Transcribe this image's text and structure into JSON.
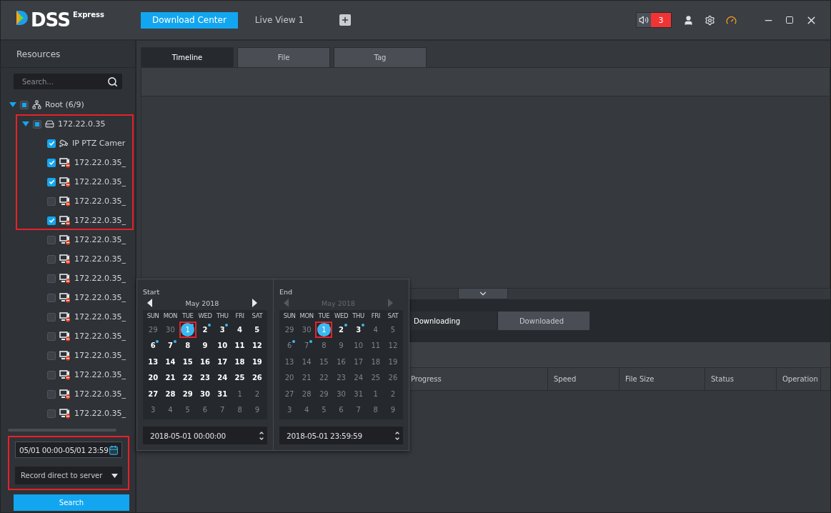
{
  "app": {
    "logo": "DSS",
    "edition": "Express"
  },
  "top_tabs": [
    {
      "label": "Download Center",
      "selected": true
    },
    {
      "label": "Live View 1",
      "selected": false
    }
  ],
  "alarm_count": "3",
  "sidebar": {
    "title": "Resources",
    "search_placeholder": "Search...",
    "tree": [
      {
        "label": "Root (6/9)",
        "kind": "root",
        "expanded": true,
        "partial": true,
        "framed": false,
        "children": [
          {
            "label": "172.22.0.35",
            "kind": "device",
            "expanded": true,
            "partial": true,
            "framed": true,
            "children": [
              {
                "label": "IP PTZ Camer",
                "kind": "ptz",
                "checked": true,
                "framed": true
              },
              {
                "label": "172.22.0.35_",
                "kind": "channel",
                "checked": true,
                "framed": true
              },
              {
                "label": "172.22.0.35_",
                "kind": "channel",
                "checked": true,
                "framed": true
              },
              {
                "label": "172.22.0.35_",
                "kind": "channel",
                "checked": false,
                "framed": true
              },
              {
                "label": "172.22.0.35_",
                "kind": "channel",
                "checked": true,
                "framed": true
              },
              {
                "label": "172.22.0.35_",
                "kind": "channel",
                "checked": false,
                "framed": false
              },
              {
                "label": "172.22.0.35_",
                "kind": "channel",
                "checked": false,
                "framed": false
              },
              {
                "label": "172.22.0.35_",
                "kind": "channel",
                "checked": false,
                "framed": false
              },
              {
                "label": "172.22.0.35_",
                "kind": "channel",
                "checked": false,
                "framed": false
              },
              {
                "label": "172.22.0.35_",
                "kind": "channel",
                "checked": false,
                "framed": false
              },
              {
                "label": "172.22.0.35_",
                "kind": "channel",
                "checked": false,
                "framed": false
              },
              {
                "label": "172.22.0.35_",
                "kind": "channel",
                "checked": false,
                "framed": false
              },
              {
                "label": "172.22.0.35_",
                "kind": "channel",
                "checked": false,
                "framed": false
              },
              {
                "label": "172.22.0.35_",
                "kind": "channel",
                "checked": false,
                "framed": false
              },
              {
                "label": "172.22.0.35_",
                "kind": "channel",
                "checked": false,
                "framed": false
              }
            ]
          }
        ]
      }
    ],
    "filters": {
      "framed": true,
      "time_range": "05/01 00:00-05/01 23:59",
      "record_source": "Record direct to server"
    },
    "search_button": "Search"
  },
  "view_tabs": [
    {
      "label": "Timeline",
      "selected": true
    },
    {
      "label": "File",
      "selected": false
    },
    {
      "label": "Tag",
      "selected": false
    }
  ],
  "task_tabs": [
    {
      "label": "Downloading",
      "selected": true
    },
    {
      "label": "Downloaded",
      "selected": false
    }
  ],
  "table": {
    "columns": [
      "Progress",
      "Speed",
      "File Size",
      "Status",
      "Operation"
    ]
  },
  "calendars": [
    {
      "label": "Start",
      "month": "May 2018",
      "nav_disabled": false,
      "time": "2018-05-01 00:00:00",
      "weekdays": [
        "SUN",
        "MON",
        "TUE",
        "WED",
        "THU",
        "FRI",
        "SAT"
      ],
      "days": [
        {
          "d": "29",
          "dim": true,
          "dot": false,
          "selected": false,
          "framed": false
        },
        {
          "d": "30",
          "dim": true,
          "dot": false,
          "selected": false,
          "framed": false
        },
        {
          "d": "1",
          "dim": false,
          "dot": true,
          "selected": true,
          "framed": true
        },
        {
          "d": "2",
          "dim": false,
          "dot": true,
          "selected": false,
          "framed": false
        },
        {
          "d": "3",
          "dim": false,
          "dot": true,
          "selected": false,
          "framed": false
        },
        {
          "d": "4",
          "dim": false,
          "dot": false,
          "selected": false,
          "framed": false
        },
        {
          "d": "5",
          "dim": false,
          "dot": false,
          "selected": false,
          "framed": false
        },
        {
          "d": "6",
          "dim": false,
          "dot": true,
          "selected": false,
          "framed": false
        },
        {
          "d": "7",
          "dim": false,
          "dot": true,
          "selected": false,
          "framed": false
        },
        {
          "d": "8",
          "dim": false,
          "dot": false,
          "selected": false,
          "framed": false
        },
        {
          "d": "9",
          "dim": false,
          "dot": false,
          "selected": false,
          "framed": false
        },
        {
          "d": "10",
          "dim": false,
          "dot": false,
          "selected": false,
          "framed": false
        },
        {
          "d": "11",
          "dim": false,
          "dot": false,
          "selected": false,
          "framed": false
        },
        {
          "d": "12",
          "dim": false,
          "dot": false,
          "selected": false,
          "framed": false
        },
        {
          "d": "13",
          "dim": false,
          "dot": false,
          "selected": false,
          "framed": false
        },
        {
          "d": "14",
          "dim": false,
          "dot": false,
          "selected": false,
          "framed": false
        },
        {
          "d": "15",
          "dim": false,
          "dot": false,
          "selected": false,
          "framed": false
        },
        {
          "d": "16",
          "dim": false,
          "dot": false,
          "selected": false,
          "framed": false
        },
        {
          "d": "17",
          "dim": false,
          "dot": false,
          "selected": false,
          "framed": false
        },
        {
          "d": "18",
          "dim": false,
          "dot": false,
          "selected": false,
          "framed": false
        },
        {
          "d": "19",
          "dim": false,
          "dot": false,
          "selected": false,
          "framed": false
        },
        {
          "d": "20",
          "dim": false,
          "dot": false,
          "selected": false,
          "framed": false
        },
        {
          "d": "21",
          "dim": false,
          "dot": false,
          "selected": false,
          "framed": false
        },
        {
          "d": "22",
          "dim": false,
          "dot": false,
          "selected": false,
          "framed": false
        },
        {
          "d": "23",
          "dim": false,
          "dot": false,
          "selected": false,
          "framed": false
        },
        {
          "d": "24",
          "dim": false,
          "dot": false,
          "selected": false,
          "framed": false
        },
        {
          "d": "25",
          "dim": false,
          "dot": false,
          "selected": false,
          "framed": false
        },
        {
          "d": "26",
          "dim": false,
          "dot": false,
          "selected": false,
          "framed": false
        },
        {
          "d": "27",
          "dim": false,
          "dot": false,
          "selected": false,
          "framed": false
        },
        {
          "d": "28",
          "dim": false,
          "dot": false,
          "selected": false,
          "framed": false
        },
        {
          "d": "29",
          "dim": false,
          "dot": false,
          "selected": false,
          "framed": false
        },
        {
          "d": "30",
          "dim": false,
          "dot": false,
          "selected": false,
          "framed": false
        },
        {
          "d": "31",
          "dim": false,
          "dot": false,
          "selected": false,
          "framed": false
        },
        {
          "d": "1",
          "dim": true,
          "dot": false,
          "selected": false,
          "framed": false
        },
        {
          "d": "2",
          "dim": true,
          "dot": false,
          "selected": false,
          "framed": false
        },
        {
          "d": "3",
          "dim": true,
          "dot": false,
          "selected": false,
          "framed": false
        },
        {
          "d": "4",
          "dim": true,
          "dot": false,
          "selected": false,
          "framed": false
        },
        {
          "d": "5",
          "dim": true,
          "dot": false,
          "selected": false,
          "framed": false
        },
        {
          "d": "6",
          "dim": true,
          "dot": false,
          "selected": false,
          "framed": false
        },
        {
          "d": "7",
          "dim": true,
          "dot": false,
          "selected": false,
          "framed": false
        },
        {
          "d": "8",
          "dim": true,
          "dot": false,
          "selected": false,
          "framed": false
        },
        {
          "d": "9",
          "dim": true,
          "dot": false,
          "selected": false,
          "framed": false
        }
      ]
    },
    {
      "label": "End",
      "month": "May 2018",
      "nav_disabled": true,
      "time": "2018-05-01 23:59:59",
      "weekdays": [
        "SUN",
        "MON",
        "TUE",
        "WED",
        "THU",
        "FRI",
        "SAT"
      ],
      "days": [
        {
          "d": "29",
          "dim": true,
          "dot": false,
          "selected": false,
          "framed": false
        },
        {
          "d": "30",
          "dim": true,
          "dot": false,
          "selected": false,
          "framed": false
        },
        {
          "d": "1",
          "dim": false,
          "dot": true,
          "selected": true,
          "framed": true
        },
        {
          "d": "2",
          "dim": false,
          "dot": true,
          "selected": false,
          "framed": false
        },
        {
          "d": "3",
          "dim": false,
          "dot": true,
          "selected": false,
          "framed": false
        },
        {
          "d": "4",
          "dim": true,
          "dot": false,
          "selected": false,
          "framed": false
        },
        {
          "d": "5",
          "dim": true,
          "dot": false,
          "selected": false,
          "framed": false
        },
        {
          "d": "6",
          "dim": true,
          "dot": true,
          "selected": false,
          "framed": false
        },
        {
          "d": "7",
          "dim": true,
          "dot": true,
          "selected": false,
          "framed": false
        },
        {
          "d": "8",
          "dim": true,
          "dot": false,
          "selected": false,
          "framed": false
        },
        {
          "d": "9",
          "dim": true,
          "dot": false,
          "selected": false,
          "framed": false
        },
        {
          "d": "10",
          "dim": true,
          "dot": false,
          "selected": false,
          "framed": false
        },
        {
          "d": "11",
          "dim": true,
          "dot": false,
          "selected": false,
          "framed": false
        },
        {
          "d": "12",
          "dim": true,
          "dot": false,
          "selected": false,
          "framed": false
        },
        {
          "d": "13",
          "dim": true,
          "dot": false,
          "selected": false,
          "framed": false
        },
        {
          "d": "14",
          "dim": true,
          "dot": false,
          "selected": false,
          "framed": false
        },
        {
          "d": "15",
          "dim": true,
          "dot": false,
          "selected": false,
          "framed": false
        },
        {
          "d": "16",
          "dim": true,
          "dot": false,
          "selected": false,
          "framed": false
        },
        {
          "d": "17",
          "dim": true,
          "dot": false,
          "selected": false,
          "framed": false
        },
        {
          "d": "18",
          "dim": true,
          "dot": false,
          "selected": false,
          "framed": false
        },
        {
          "d": "19",
          "dim": true,
          "dot": false,
          "selected": false,
          "framed": false
        },
        {
          "d": "20",
          "dim": true,
          "dot": false,
          "selected": false,
          "framed": false
        },
        {
          "d": "21",
          "dim": true,
          "dot": false,
          "selected": false,
          "framed": false
        },
        {
          "d": "22",
          "dim": true,
          "dot": false,
          "selected": false,
          "framed": false
        },
        {
          "d": "23",
          "dim": true,
          "dot": false,
          "selected": false,
          "framed": false
        },
        {
          "d": "24",
          "dim": true,
          "dot": false,
          "selected": false,
          "framed": false
        },
        {
          "d": "25",
          "dim": true,
          "dot": false,
          "selected": false,
          "framed": false
        },
        {
          "d": "26",
          "dim": true,
          "dot": false,
          "selected": false,
          "framed": false
        },
        {
          "d": "27",
          "dim": true,
          "dot": false,
          "selected": false,
          "framed": false
        },
        {
          "d": "28",
          "dim": true,
          "dot": false,
          "selected": false,
          "framed": false
        },
        {
          "d": "29",
          "dim": true,
          "dot": false,
          "selected": false,
          "framed": false
        },
        {
          "d": "30",
          "dim": true,
          "dot": false,
          "selected": false,
          "framed": false
        },
        {
          "d": "31",
          "dim": true,
          "dot": false,
          "selected": false,
          "framed": false
        },
        {
          "d": "1",
          "dim": true,
          "dot": false,
          "selected": false,
          "framed": false
        },
        {
          "d": "2",
          "dim": true,
          "dot": false,
          "selected": false,
          "framed": false
        },
        {
          "d": "3",
          "dim": true,
          "dot": false,
          "selected": false,
          "framed": false
        },
        {
          "d": "4",
          "dim": true,
          "dot": false,
          "selected": false,
          "framed": false
        },
        {
          "d": "5",
          "dim": true,
          "dot": false,
          "selected": false,
          "framed": false
        },
        {
          "d": "6",
          "dim": true,
          "dot": false,
          "selected": false,
          "framed": false
        },
        {
          "d": "7",
          "dim": true,
          "dot": false,
          "selected": false,
          "framed": false
        },
        {
          "d": "8",
          "dim": true,
          "dot": false,
          "selected": false,
          "framed": false
        },
        {
          "d": "9",
          "dim": true,
          "dot": false,
          "selected": false,
          "framed": false
        }
      ]
    }
  ]
}
